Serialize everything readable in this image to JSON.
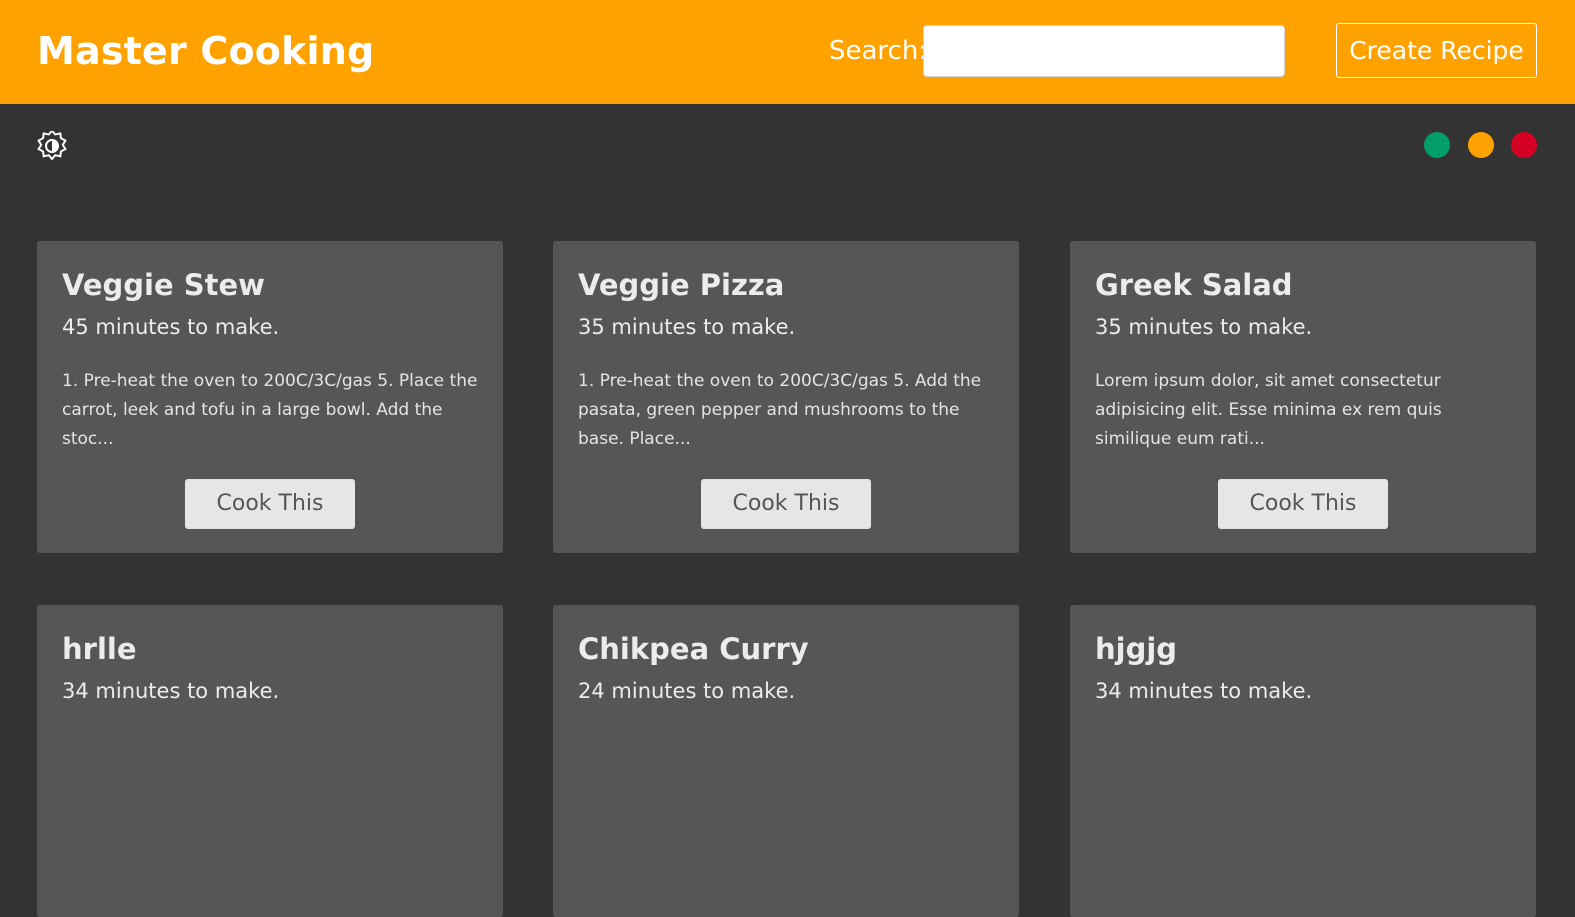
{
  "header": {
    "brand": "Master Cooking",
    "search_label": "Search:",
    "search_value": "",
    "search_placeholder": "",
    "create_button": "Create Recipe",
    "background_color": "#ffa200"
  },
  "controls": {
    "theme_toggle_icon": "brightness-contrast-icon",
    "color_options": [
      {
        "name": "green",
        "color": "#009e6a"
      },
      {
        "name": "orange",
        "color": "#ffa200"
      },
      {
        "name": "red",
        "color": "#d60024"
      }
    ]
  },
  "recipes": [
    {
      "title": "Veggie Stew",
      "time": "45 minutes to make.",
      "description": "1. Pre-heat the oven to 200C/3C/gas 5. Place the carrot, leek and tofu in a large bowl. Add the stoc...",
      "button": "Cook This"
    },
    {
      "title": "Veggie Pizza",
      "time": "35 minutes to make.",
      "description": "1. Pre-heat the oven to 200C/3C/gas 5. Add the pasata, green pepper and mushrooms to the base. Place...",
      "button": "Cook This"
    },
    {
      "title": "Greek Salad",
      "time": "35 minutes to make.",
      "description": "Lorem ipsum dolor, sit amet consectetur adipisicing elit. Esse minima ex rem quis similique eum rati...",
      "button": "Cook This"
    },
    {
      "title": "hrlle",
      "time": "34 minutes to make.",
      "description": "",
      "button": ""
    },
    {
      "title": "Chikpea Curry",
      "time": "24 minutes to make.",
      "description": "",
      "button": ""
    },
    {
      "title": "hjgjg",
      "time": "34 minutes to make.",
      "description": "",
      "button": ""
    }
  ],
  "colors": {
    "page_background": "#333333",
    "card_background": "#565656",
    "button_background": "#e6e6e6"
  }
}
